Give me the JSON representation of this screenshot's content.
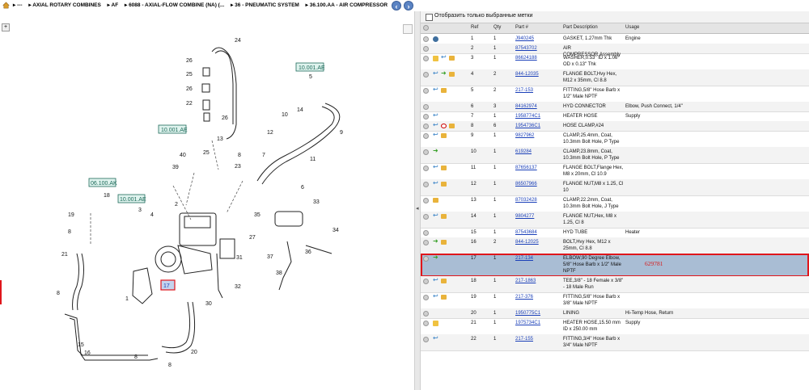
{
  "breadcrumb": {
    "items": [
      "---",
      "AXIAL ROTARY COMBINES",
      "AF",
      "6088 - AXIAL-FLOW COMBINE (NA) (...",
      "36 - PNEUMATIC SYSTEM",
      "36.100.AA - AIR COMPRESSOR"
    ]
  },
  "nav": {
    "back": "‹",
    "forward": "›"
  },
  "filter": {
    "label": "Отобразить только выбранные метки"
  },
  "columns": {
    "ref": "Ref",
    "qty": "Qty",
    "part": "Part #",
    "desc": "Part Description",
    "usage": "Usage"
  },
  "selected_mark": "629781",
  "diagram": {
    "callouts": [
      "24",
      "26",
      "25",
      "26",
      "22",
      "26",
      "13",
      "10.001.AE",
      "10.001.AE",
      "5",
      "14",
      "10",
      "12",
      "11",
      "9",
      "7",
      "40",
      "25",
      "39",
      "8",
      "23",
      "6",
      "2",
      "1",
      "30",
      "31",
      "32",
      "37",
      "36",
      "35",
      "34",
      "33",
      "27",
      "38",
      "3",
      "4",
      "18",
      "19",
      "8",
      "21",
      "8",
      "15",
      "16",
      "8",
      "20",
      "8",
      "17",
      "06.100.AK",
      "10.001.AE"
    ],
    "labels_box": [
      "10.001.AE",
      "10.001.AE",
      "06.100.AK",
      "10.001.AE"
    ],
    "selected_ref": "17"
  },
  "parts": [
    {
      "ref": "1",
      "qty": "1",
      "part": "J940245",
      "desc": "GASKET, 1.27mm Thk",
      "usage": "Engine",
      "icons": [
        "globe"
      ]
    },
    {
      "ref": "2",
      "qty": "1",
      "part": "87543702",
      "desc": "AIR COMPRESSOR,Assembly",
      "usage": "",
      "icons": []
    },
    {
      "ref": "3",
      "qty": "1",
      "part": "86624188",
      "desc": "WASHER,0.53\" ID x 1.06\" OD x 0.13\" Thk",
      "usage": "",
      "icons": [
        "note",
        "arrow",
        "box"
      ]
    },
    {
      "ref": "4",
      "qty": "2",
      "part": "844-12035",
      "desc": "FLANGE BOLT,Hvy Hex, M12 x 35mm, Cl 8.8",
      "usage": "",
      "icons": [
        "arrow",
        "green",
        "box"
      ]
    },
    {
      "ref": "5",
      "qty": "2",
      "part": "217-153",
      "desc": "FITTING,5/8\" Hose Barb x 1/2\" Male NPTF",
      "usage": "",
      "icons": [
        "arrow",
        "box"
      ]
    },
    {
      "ref": "6",
      "qty": "3",
      "part": "84162974",
      "desc": "HYD CONNECTOR",
      "usage": "Elbow, Push Connect, 1/4\"",
      "icons": []
    },
    {
      "ref": "7",
      "qty": "1",
      "part": "1958774C1",
      "desc": "HEATER HOSE",
      "usage": "Supply",
      "icons": [
        "arrow"
      ]
    },
    {
      "ref": "8",
      "qty": "6",
      "part": "1954736C1",
      "desc": "HOSE CLAMP,#24",
      "usage": "",
      "icons": [
        "arrow",
        "grid",
        "box"
      ]
    },
    {
      "ref": "9",
      "qty": "1",
      "part": "9827962",
      "desc": "CLAMP,25.4mm, Coat, 10.3mm Bolt Hole, P Type",
      "usage": "",
      "icons": [
        "arrow",
        "box"
      ]
    },
    {
      "ref": "10",
      "qty": "1",
      "part": "619284",
      "desc": "CLAMP,23.8mm, Coat, 10.3mm Bolt Hole, P Type",
      "usage": "",
      "icons": [
        "green"
      ]
    },
    {
      "ref": "11",
      "qty": "1",
      "part": "87656137",
      "desc": "FLANGE BOLT,Flange Hex, M8 x 20mm, Cl 10.9",
      "usage": "",
      "icons": [
        "arrow",
        "box"
      ]
    },
    {
      "ref": "12",
      "qty": "1",
      "part": "86507966",
      "desc": "FLANGE NUT,M8 x 1.25, Cl 10",
      "usage": "",
      "icons": [
        "arrow",
        "box"
      ]
    },
    {
      "ref": "13",
      "qty": "1",
      "part": "87032428",
      "desc": "CLAMP,22.2mm, Coat, 10.3mm Bolt Hole, J Type",
      "usage": "",
      "icons": [
        "box"
      ]
    },
    {
      "ref": "14",
      "qty": "1",
      "part": "9804277",
      "desc": "FLANGE NUT,Hex, M8 x 1.25, Cl 8",
      "usage": "",
      "icons": [
        "arrow",
        "box"
      ]
    },
    {
      "ref": "15",
      "qty": "1",
      "part": "87543684",
      "desc": "HYD TUBE",
      "usage": "Heater",
      "icons": []
    },
    {
      "ref": "16",
      "qty": "2",
      "part": "844-12025",
      "desc": "BOLT,Hvy Hex, M12 x 25mm, Cl 8.8",
      "usage": "",
      "icons": [
        "green",
        "box"
      ]
    },
    {
      "ref": "17",
      "qty": "1",
      "part": "217-134",
      "desc": "ELBOW,90 Degree Elbow, 5/8\" Hose Barb x 1/2\" Male NPTF",
      "usage": "",
      "icons": [
        "green"
      ],
      "selected": true
    },
    {
      "ref": "18",
      "qty": "1",
      "part": "217-1863",
      "desc": "TEE,3/8\" - 18 Female x 3/8\" - 18 Male Run",
      "usage": "",
      "icons": [
        "arrow",
        "box"
      ]
    },
    {
      "ref": "19",
      "qty": "1",
      "part": "217-376",
      "desc": "FITTING,5/8\" Hose Barb x 3/8\" Male NPTF",
      "usage": "",
      "icons": [
        "arrow",
        "box"
      ]
    },
    {
      "ref": "20",
      "qty": "1",
      "part": "1950775C1",
      "desc": "LINING",
      "usage": "Hi-Temp Hose, Return",
      "icons": []
    },
    {
      "ref": "21",
      "qty": "1",
      "part": "1975734C1",
      "desc": "HEATER HOSE,15.50 mm ID x 250.00 mm",
      "usage": "Supply",
      "icons": [
        "note"
      ]
    },
    {
      "ref": "22",
      "qty": "1",
      "part": "217-155",
      "desc": "FITTING,3/4\" Hose Barb x 3/4\" Male NPTF",
      "usage": "",
      "icons": [
        "arrow"
      ]
    }
  ]
}
